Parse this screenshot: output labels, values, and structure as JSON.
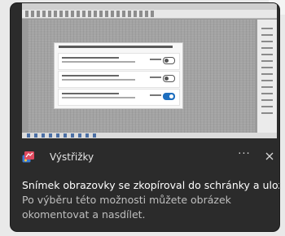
{
  "notification": {
    "app_name": "Výstřižky",
    "title": "Snímek obrazovky se zkopíroval do schránky a uložil.",
    "body": "Po výběru této možnosti můžete obrázek okomentovat a nasdílet.",
    "more_label": "···",
    "icons": {
      "app": "snipping-tool-icon",
      "more": "more-options-icon",
      "close": "close-icon"
    }
  },
  "colors": {
    "toast_background": "#2b2b2b",
    "title_text": "#ffffff",
    "body_text": "#bfbfbf",
    "accent": "#1f6fbf"
  }
}
